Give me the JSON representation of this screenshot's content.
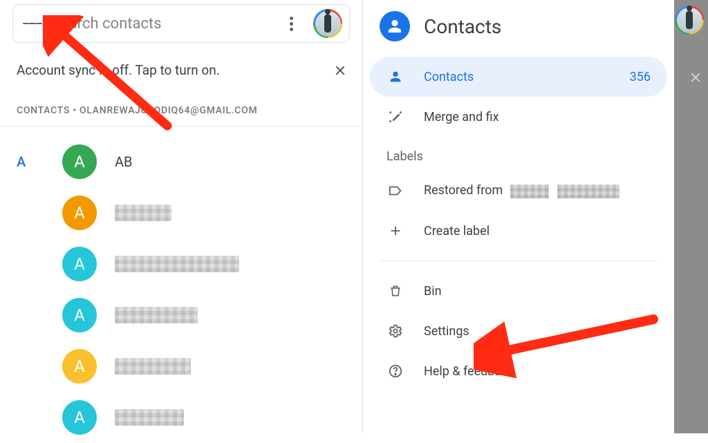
{
  "left": {
    "search_placeholder": "Search contacts",
    "sync_text": "Account sync is off. Tap to turn on.",
    "account_line": "CONTACTS • OLANREWAJUSODIQ64@GMAIL.COM",
    "section_letter": "A",
    "contacts": [
      {
        "initial": "A",
        "name": "AB",
        "color": "c-green",
        "redacted": false
      },
      {
        "initial": "A",
        "name": "",
        "color": "c-orange",
        "redacted": true,
        "redact_width": 82
      },
      {
        "initial": "A",
        "name": "",
        "color": "c-cyan",
        "redacted": true,
        "redact_width": 180
      },
      {
        "initial": "A",
        "name": "",
        "color": "c-cyan",
        "redacted": true,
        "redact_width": 120
      },
      {
        "initial": "A",
        "name": "",
        "color": "c-yellow",
        "redacted": true,
        "redact_width": 110
      },
      {
        "initial": "A",
        "name": "",
        "color": "c-cyan",
        "redacted": true,
        "redact_width": 100
      }
    ]
  },
  "right": {
    "title": "Contacts",
    "items": {
      "contacts": {
        "label": "Contacts",
        "count": "356"
      },
      "merge": {
        "label": "Merge and fix"
      },
      "labels_header": "Labels",
      "restored": {
        "label": "Restored from"
      },
      "create_label": {
        "label": "Create label"
      },
      "bin": {
        "label": "Bin"
      },
      "settings": {
        "label": "Settings"
      },
      "help": {
        "label": "Help & feedback"
      }
    }
  }
}
